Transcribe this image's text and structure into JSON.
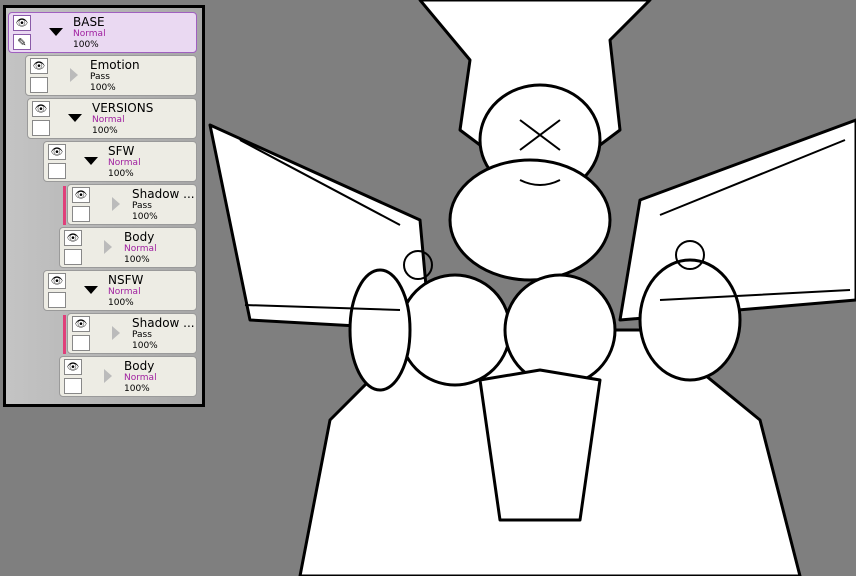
{
  "layers_panel": {
    "layers": [
      {
        "name": "BASE",
        "mode": "Normal",
        "opacity": "100%",
        "expanded": true,
        "selected": true
      },
      {
        "name": "Emotion",
        "mode": "Pass",
        "opacity": "100%",
        "expanded": false
      },
      {
        "name": "VERSIONS",
        "mode": "Normal",
        "opacity": "100%",
        "expanded": true
      },
      {
        "name": "SFW",
        "mode": "Normal",
        "opacity": "100%",
        "expanded": true
      },
      {
        "name": "Shadow ...",
        "mode": "Pass",
        "opacity": "100%",
        "expanded": false
      },
      {
        "name": "Body",
        "mode": "Normal",
        "opacity": "100%",
        "expanded": false
      },
      {
        "name": "NSFW",
        "mode": "Normal",
        "opacity": "100%",
        "expanded": true
      },
      {
        "name": "Shadow ...",
        "mode": "Pass",
        "opacity": "100%",
        "expanded": false
      },
      {
        "name": "Body",
        "mode": "Normal",
        "opacity": "100%",
        "expanded": false
      }
    ]
  },
  "colors": {
    "canvas_bg": "#7f7f7f",
    "selected_layer": "#ead9f2",
    "normal_mode": "#a020a0",
    "tag": "#e0407a"
  }
}
